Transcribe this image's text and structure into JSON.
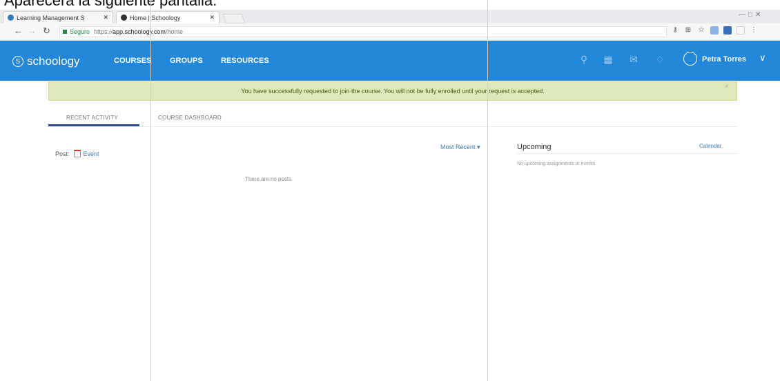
{
  "caption": "Aparecerá la siguiente pantalla:",
  "browser": {
    "tabs": [
      {
        "title": "Learning Management S"
      },
      {
        "title": "Home | Schoology"
      }
    ],
    "secure_label": "Seguro",
    "url_scheme": "https://",
    "url_host": "app.schoology.com",
    "url_path": "/home"
  },
  "nav": {
    "brand": "schoology",
    "links": [
      "COURSES",
      "GROUPS",
      "RESOURCES"
    ],
    "username": "Petra Torres",
    "color": "#2287d9"
  },
  "alert": {
    "text": "You have successfully requested to join the course. You will not be fully enrolled until your request is accepted.",
    "color": "#dde9b9"
  },
  "tabs": {
    "recent_activity": "RECENT ACTIVITY",
    "course_dashboard": "COURSE DASHBOARD"
  },
  "feed": {
    "post_label": "Post:",
    "event_label": "Event",
    "sort_label": "Most Recent ▾",
    "empty_text": "There are no posts"
  },
  "upcoming": {
    "title": "Upcoming",
    "calendar_link": "Calendar",
    "empty_text": "No upcoming assignments or events"
  }
}
